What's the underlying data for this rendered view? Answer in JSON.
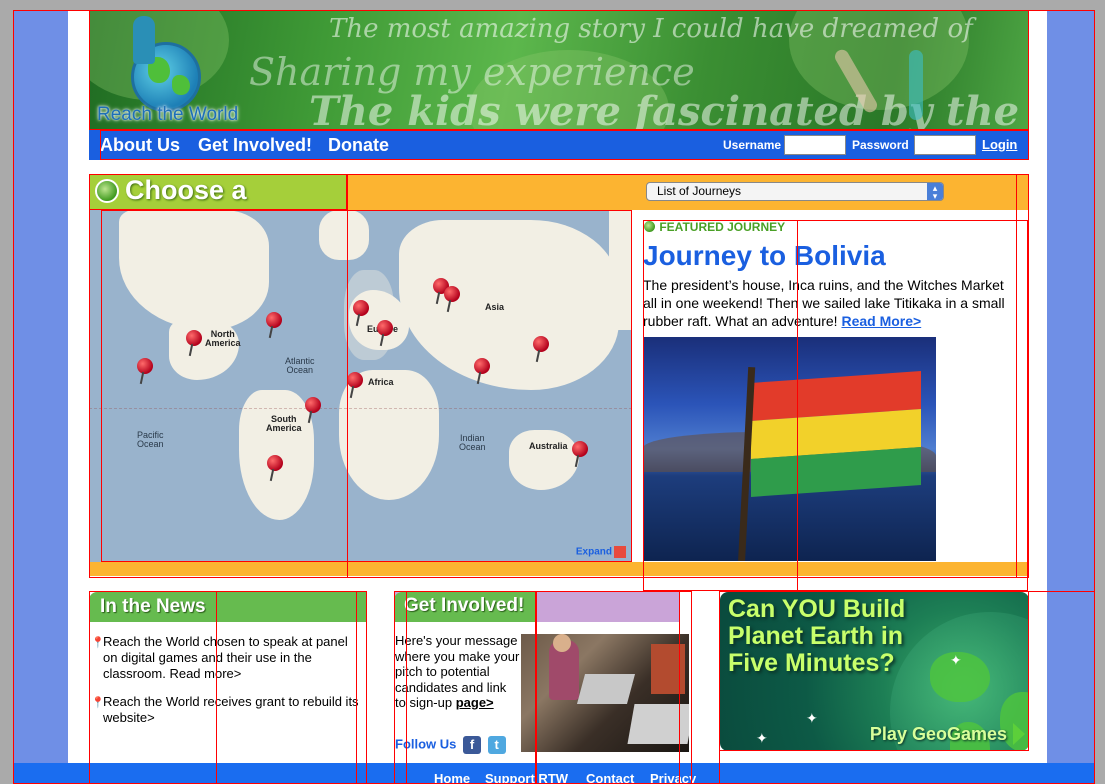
{
  "banner": {
    "logo_text": "Reach the World",
    "script_line1": "The most amazing story I could have dreamed of",
    "script_line2": "Sharing my experience",
    "script_line3": "The kids were fascinated by the persp..."
  },
  "nav": {
    "items": [
      {
        "label": "About Us"
      },
      {
        "label": "Get Involved!"
      },
      {
        "label": "Donate"
      }
    ],
    "username_label": "Username",
    "password_label": "Password",
    "login_label": "Login"
  },
  "journey": {
    "title": "Choose a Journey",
    "select_value": "List of Journeys"
  },
  "map": {
    "labels": {
      "north_america": "North\nAmerica",
      "south_america": "South\nAmerica",
      "europe": "Europe",
      "asia": "Asia",
      "africa": "Africa",
      "australia": "Australia",
      "atlantic": "Atlantic\nOcean",
      "pacific": "Pacific\nOcean",
      "indian": "Indian\nOcean"
    },
    "expand_label": "Expand"
  },
  "featured": {
    "tag": "FEATURED JOURNEY",
    "title": "Journey to Bolivia",
    "description": "The president’s house, Inca ruins, and the Witches Market all in one weekend! Then we sailed lake Titikaka in a small rubber raft. What an adventure!",
    "read_more": "Read More>"
  },
  "news": {
    "title": "In the News",
    "items": [
      {
        "text": "Reach the World chosen to speak at panel on digital games and their use in the classroom. Read more>"
      },
      {
        "text": "Reach the World receives grant to rebuild its website>"
      }
    ]
  },
  "get_involved": {
    "title": "Get Involved!",
    "text": "Here's your message where you make your pitch to potential candidates and link to sign-up ",
    "link": "page>",
    "follow": "Follow Us",
    "facebook": "f",
    "twitter": "t"
  },
  "geogames": {
    "title": "Can YOU Build Planet Earth in Five Minutes?",
    "play": "Play GeoGames"
  },
  "footer": {
    "links": [
      {
        "label": "Home"
      },
      {
        "label": "Support RTW"
      },
      {
        "label": "Contact"
      },
      {
        "label": "Privacy"
      }
    ]
  },
  "colors": {
    "nav_blue": "#1a5fe0",
    "journey_orange": "#fcb431",
    "green_header": "#66bb4f",
    "purple_header": "#caa4d8"
  }
}
